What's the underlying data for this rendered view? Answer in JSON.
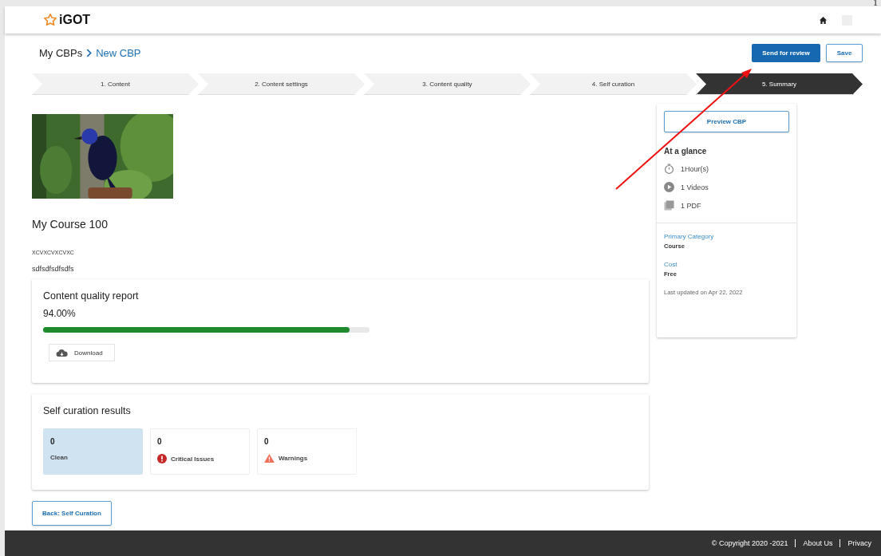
{
  "corner_mark": "1",
  "header": {
    "logo": "iGOT"
  },
  "breadcrumb": {
    "parent": "My CBPs",
    "current": "New CBP"
  },
  "actions": {
    "primary": "Send for review",
    "secondary": "Save"
  },
  "steps": [
    {
      "label": "1. Content",
      "selected": false
    },
    {
      "label": "2. Content settings",
      "selected": false
    },
    {
      "label": "3. Content quality",
      "selected": false
    },
    {
      "label": "4. Self curation",
      "selected": false
    },
    {
      "label": "5. Summary",
      "selected": true
    }
  ],
  "course": {
    "title": "My Course 100",
    "subtitle": "XCVXCVXCVXC",
    "description": "sdfsdfsdfsdfs"
  },
  "quality_report": {
    "title": "Content quality report",
    "score": "94.00%",
    "level": 0.94,
    "download": "Download"
  },
  "self_curation": {
    "title": "Self curation results",
    "results": [
      {
        "count": "0",
        "label": "Clean",
        "kind": "clean",
        "selected": true
      },
      {
        "count": "0",
        "label": "Critical Issues",
        "kind": "critical",
        "selected": false
      },
      {
        "count": "0",
        "label": "Warnings",
        "kind": "warning",
        "selected": false
      }
    ]
  },
  "back_button": "Back: Self Curation",
  "summary": {
    "preview": "Preview CBP",
    "glance_title": "At a glance",
    "glance": [
      {
        "kind": "duration",
        "text": "1Hour(s)"
      },
      {
        "kind": "video",
        "text": "1 Videos"
      },
      {
        "kind": "pdf",
        "text": "1 PDF"
      }
    ],
    "fields": [
      {
        "label": "Primary Category",
        "value": "Course"
      },
      {
        "label": "Cost",
        "value": "Free"
      }
    ],
    "updated": "Last updated on Apr 22, 2022"
  },
  "footer": {
    "copyright": "© Copyright 2020 -2021",
    "links": [
      "About Us",
      "Privacy"
    ]
  }
}
